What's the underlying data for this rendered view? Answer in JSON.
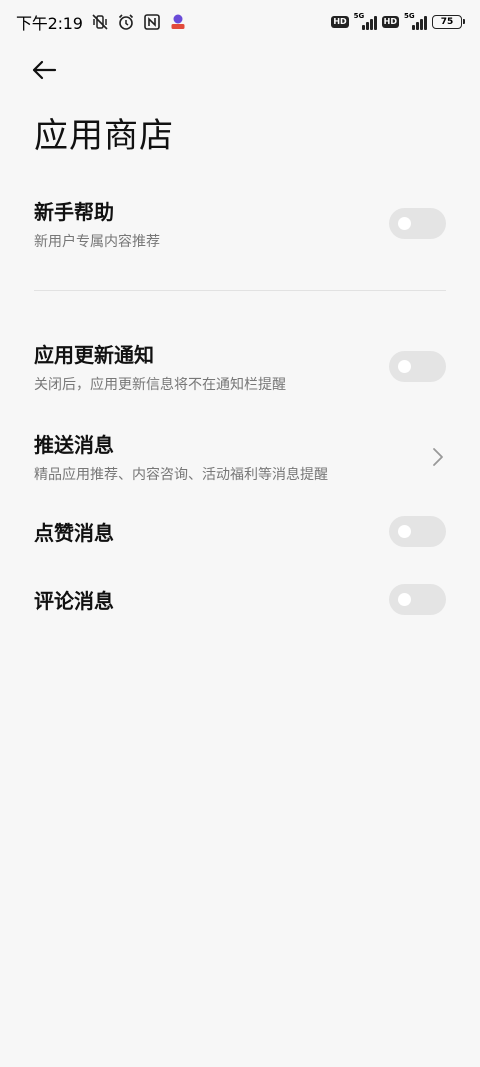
{
  "status_bar": {
    "time": "下午2:19",
    "sim1": {
      "hd": "HD",
      "network": "5G"
    },
    "sim2": {
      "hd": "HD",
      "network": "5G"
    },
    "battery": "75",
    "icons": [
      "mute-vibrate-icon",
      "alarm-clock-icon",
      "nfc-icon",
      "app-notification-icon"
    ]
  },
  "header": {
    "title": "应用商店"
  },
  "settings": {
    "newbie_help": {
      "title": "新手帮助",
      "subtitle": "新用户专属内容推荐",
      "enabled": false
    },
    "update_notice": {
      "title": "应用更新通知",
      "subtitle": "关闭后，应用更新信息将不在通知栏提醒",
      "enabled": false
    },
    "push_messages": {
      "title": "推送消息",
      "subtitle": "精品应用推荐、内容咨询、活动福利等消息提醒"
    },
    "like_messages": {
      "title": "点赞消息",
      "enabled": false
    },
    "comment_messages": {
      "title": "评论消息",
      "enabled": false
    }
  },
  "colors": {
    "background": "#f7f7f7",
    "toggle_off": "#e4e4e4",
    "subtitle": "#777777",
    "divider": "#e2e2e2"
  }
}
